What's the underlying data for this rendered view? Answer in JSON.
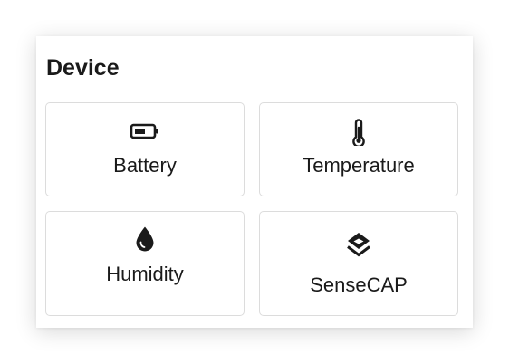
{
  "section": {
    "title": "Device"
  },
  "tiles": [
    {
      "label": "Battery",
      "icon": "battery-icon"
    },
    {
      "label": "Temperature",
      "icon": "thermometer-icon"
    },
    {
      "label": "Humidity",
      "icon": "water-drop-icon"
    },
    {
      "label": "SenseCAP",
      "icon": "sensecap-logo-icon"
    }
  ],
  "colors": {
    "text": "#1a1a1a",
    "border": "#dcdcdc",
    "background": "#ffffff"
  }
}
